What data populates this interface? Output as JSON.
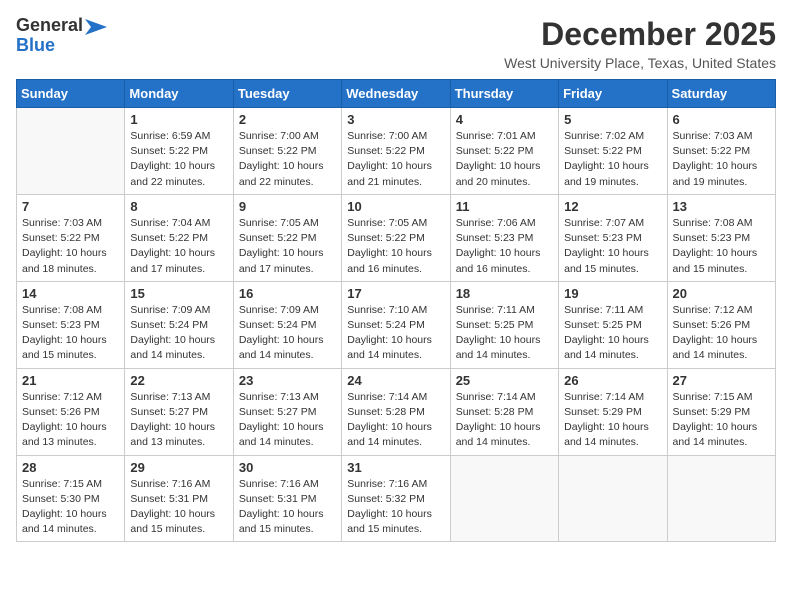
{
  "header": {
    "logo_line1": "General",
    "logo_line2": "Blue",
    "month_title": "December 2025",
    "location": "West University Place, Texas, United States"
  },
  "weekdays": [
    "Sunday",
    "Monday",
    "Tuesday",
    "Wednesday",
    "Thursday",
    "Friday",
    "Saturday"
  ],
  "weeks": [
    [
      {
        "day": "",
        "info": ""
      },
      {
        "day": "1",
        "info": "Sunrise: 6:59 AM\nSunset: 5:22 PM\nDaylight: 10 hours\nand 22 minutes."
      },
      {
        "day": "2",
        "info": "Sunrise: 7:00 AM\nSunset: 5:22 PM\nDaylight: 10 hours\nand 22 minutes."
      },
      {
        "day": "3",
        "info": "Sunrise: 7:00 AM\nSunset: 5:22 PM\nDaylight: 10 hours\nand 21 minutes."
      },
      {
        "day": "4",
        "info": "Sunrise: 7:01 AM\nSunset: 5:22 PM\nDaylight: 10 hours\nand 20 minutes."
      },
      {
        "day": "5",
        "info": "Sunrise: 7:02 AM\nSunset: 5:22 PM\nDaylight: 10 hours\nand 19 minutes."
      },
      {
        "day": "6",
        "info": "Sunrise: 7:03 AM\nSunset: 5:22 PM\nDaylight: 10 hours\nand 19 minutes."
      }
    ],
    [
      {
        "day": "7",
        "info": "Sunrise: 7:03 AM\nSunset: 5:22 PM\nDaylight: 10 hours\nand 18 minutes."
      },
      {
        "day": "8",
        "info": "Sunrise: 7:04 AM\nSunset: 5:22 PM\nDaylight: 10 hours\nand 17 minutes."
      },
      {
        "day": "9",
        "info": "Sunrise: 7:05 AM\nSunset: 5:22 PM\nDaylight: 10 hours\nand 17 minutes."
      },
      {
        "day": "10",
        "info": "Sunrise: 7:05 AM\nSunset: 5:22 PM\nDaylight: 10 hours\nand 16 minutes."
      },
      {
        "day": "11",
        "info": "Sunrise: 7:06 AM\nSunset: 5:23 PM\nDaylight: 10 hours\nand 16 minutes."
      },
      {
        "day": "12",
        "info": "Sunrise: 7:07 AM\nSunset: 5:23 PM\nDaylight: 10 hours\nand 15 minutes."
      },
      {
        "day": "13",
        "info": "Sunrise: 7:08 AM\nSunset: 5:23 PM\nDaylight: 10 hours\nand 15 minutes."
      }
    ],
    [
      {
        "day": "14",
        "info": "Sunrise: 7:08 AM\nSunset: 5:23 PM\nDaylight: 10 hours\nand 15 minutes."
      },
      {
        "day": "15",
        "info": "Sunrise: 7:09 AM\nSunset: 5:24 PM\nDaylight: 10 hours\nand 14 minutes."
      },
      {
        "day": "16",
        "info": "Sunrise: 7:09 AM\nSunset: 5:24 PM\nDaylight: 10 hours\nand 14 minutes."
      },
      {
        "day": "17",
        "info": "Sunrise: 7:10 AM\nSunset: 5:24 PM\nDaylight: 10 hours\nand 14 minutes."
      },
      {
        "day": "18",
        "info": "Sunrise: 7:11 AM\nSunset: 5:25 PM\nDaylight: 10 hours\nand 14 minutes."
      },
      {
        "day": "19",
        "info": "Sunrise: 7:11 AM\nSunset: 5:25 PM\nDaylight: 10 hours\nand 14 minutes."
      },
      {
        "day": "20",
        "info": "Sunrise: 7:12 AM\nSunset: 5:26 PM\nDaylight: 10 hours\nand 14 minutes."
      }
    ],
    [
      {
        "day": "21",
        "info": "Sunrise: 7:12 AM\nSunset: 5:26 PM\nDaylight: 10 hours\nand 13 minutes."
      },
      {
        "day": "22",
        "info": "Sunrise: 7:13 AM\nSunset: 5:27 PM\nDaylight: 10 hours\nand 13 minutes."
      },
      {
        "day": "23",
        "info": "Sunrise: 7:13 AM\nSunset: 5:27 PM\nDaylight: 10 hours\nand 14 minutes."
      },
      {
        "day": "24",
        "info": "Sunrise: 7:14 AM\nSunset: 5:28 PM\nDaylight: 10 hours\nand 14 minutes."
      },
      {
        "day": "25",
        "info": "Sunrise: 7:14 AM\nSunset: 5:28 PM\nDaylight: 10 hours\nand 14 minutes."
      },
      {
        "day": "26",
        "info": "Sunrise: 7:14 AM\nSunset: 5:29 PM\nDaylight: 10 hours\nand 14 minutes."
      },
      {
        "day": "27",
        "info": "Sunrise: 7:15 AM\nSunset: 5:29 PM\nDaylight: 10 hours\nand 14 minutes."
      }
    ],
    [
      {
        "day": "28",
        "info": "Sunrise: 7:15 AM\nSunset: 5:30 PM\nDaylight: 10 hours\nand 14 minutes."
      },
      {
        "day": "29",
        "info": "Sunrise: 7:16 AM\nSunset: 5:31 PM\nDaylight: 10 hours\nand 15 minutes."
      },
      {
        "day": "30",
        "info": "Sunrise: 7:16 AM\nSunset: 5:31 PM\nDaylight: 10 hours\nand 15 minutes."
      },
      {
        "day": "31",
        "info": "Sunrise: 7:16 AM\nSunset: 5:32 PM\nDaylight: 10 hours\nand 15 minutes."
      },
      {
        "day": "",
        "info": ""
      },
      {
        "day": "",
        "info": ""
      },
      {
        "day": "",
        "info": ""
      }
    ]
  ]
}
